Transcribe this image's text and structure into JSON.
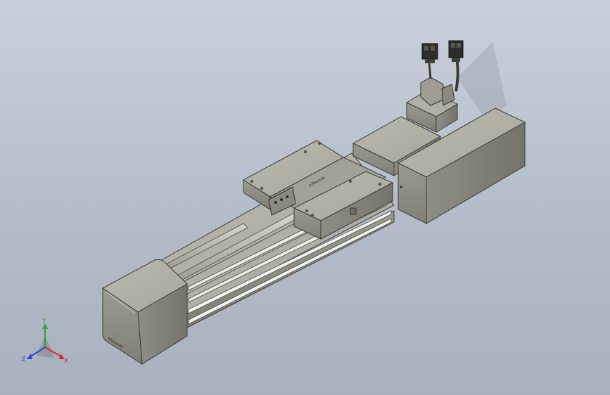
{
  "viewport": {
    "background_top": "#c9d0dc",
    "background_bottom": "#a9b1bf"
  },
  "model": {
    "description_hidden": "",
    "brand_mark": "∧Rexroth",
    "carriage_mark": "∧Rexroth"
  },
  "triad": {
    "x_label": "X",
    "y_label": "Y",
    "z_label": "Z",
    "x_color": "#d8262a",
    "y_color": "#2aa52e",
    "z_color": "#2b49c9"
  }
}
